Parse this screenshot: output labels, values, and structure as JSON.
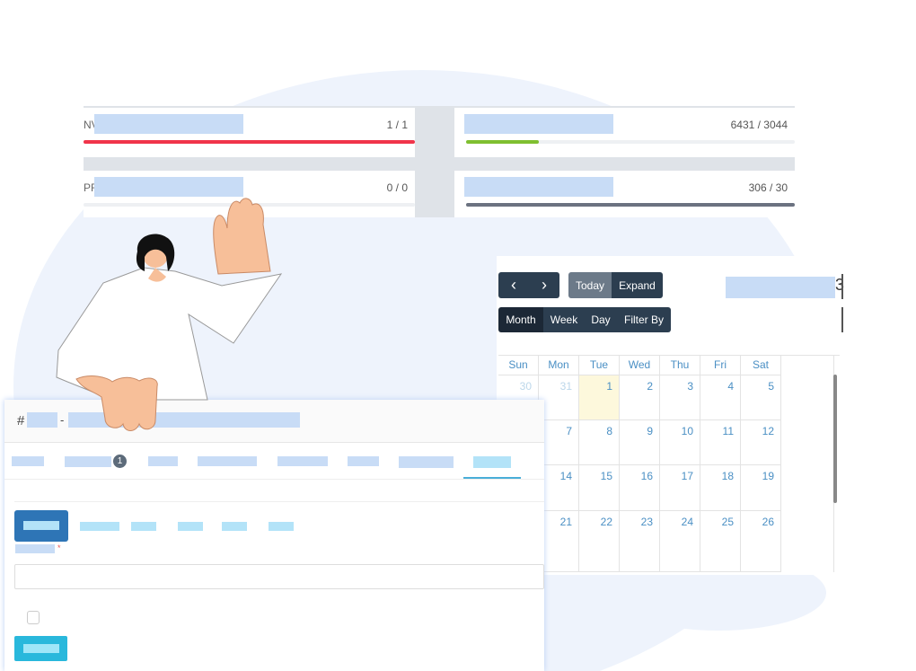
{
  "dashboard": {
    "cards": [
      {
        "prefix": "NV",
        "value": "1 / 1",
        "progress": 100,
        "color": "#f0344a"
      },
      {
        "prefix": "",
        "value": "6431 / 3044",
        "progress": 20,
        "color": "#7fbf30"
      },
      {
        "prefix": "PR",
        "value": "0 / 0",
        "progress": 0,
        "color": "#eef0f3"
      },
      {
        "prefix": "",
        "value": "306 / 30",
        "progress": 100,
        "color": "#6b7280"
      }
    ]
  },
  "calendar": {
    "prev_icon": "chevron-left-icon",
    "next_icon": "chevron-right-icon",
    "today": "Today",
    "expand": "Expand",
    "title_suffix": "3",
    "views": [
      "Month",
      "Week",
      "Day",
      "Filter By"
    ],
    "active_view": "Month",
    "days": [
      "Sun",
      "Mon",
      "Tue",
      "Wed",
      "Thu",
      "Fri",
      "Sat"
    ],
    "weeks": [
      [
        "30",
        "31",
        "1",
        "2",
        "3",
        "4",
        "5"
      ],
      [
        "",
        "7",
        "8",
        "9",
        "10",
        "11",
        "12"
      ],
      [
        "",
        "14",
        "15",
        "16",
        "17",
        "18",
        "19"
      ],
      [
        "",
        "21",
        "22",
        "23",
        "24",
        "25",
        "26"
      ]
    ],
    "today_date": "1"
  },
  "form": {
    "hash": "#",
    "dash": "-",
    "tab_badge": "1",
    "required_mark": "*"
  },
  "colors": {
    "accent": "#2e75b6",
    "dark": "#2c3e50",
    "cyan": "#29b8dc"
  }
}
